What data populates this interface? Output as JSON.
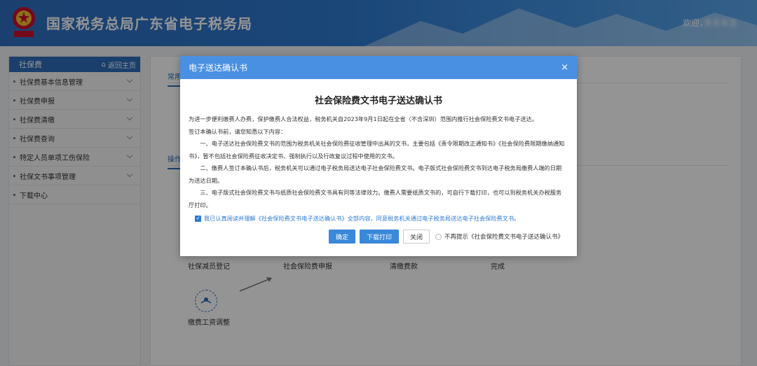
{
  "header": {
    "title": "国家税务总局广东省电子税务局",
    "welcome": "欢迎，",
    "username": "黄某某某"
  },
  "sidebar": {
    "title": "社保费",
    "home_link": "返回主页",
    "items": [
      {
        "label": "社保费基本信息管理"
      },
      {
        "label": "社保费申报"
      },
      {
        "label": "社保费清缴"
      },
      {
        "label": "社保费查询"
      },
      {
        "label": "特定人员单项工伤保险"
      },
      {
        "label": "社保文书事项管理"
      },
      {
        "label": "下载中心"
      }
    ]
  },
  "main": {
    "tab_common": "常用",
    "tab_operation": "操作",
    "steps": [
      {
        "label": "社保减员登记"
      },
      {
        "label": "社会保险费申报"
      },
      {
        "label": "清缴费款"
      },
      {
        "label": "完成"
      }
    ],
    "flow_label": "缴费工资调整"
  },
  "modal": {
    "header": "电子送达确认书",
    "close": "×",
    "title": "社会保险费文书电子送达确认书",
    "para1": "为进一步便利缴费人办费，保护缴费人合法权益，税务机关自2023年9月1日起在全省（不含深圳）范围内推行社会保险费文书电子送达。",
    "para2": "签订本确认书前，请您知悉以下内容：",
    "para3": "一、电子送达社会保险费文书的范围为税务机关社会保险费征收管理中出具的文书，主要包括《责令限期改正通知书》《社会保险费限期缴纳通知书》，暂不包括社会保险费征收决定书、强制执行以及行政复议过程中使用的文书。",
    "para4": "二、缴费人签订本确认书后，税务机关可以通过电子税务局送达电子社会保险费文书。电子版式社会保险费文书到达电子税务局缴费人端的日期为送达日期。",
    "para5": "三、电子版式社会保险费文书与纸质社会保险费文书具有同等法律效力。缴费人需要纸质文书的，可自行下载打印，也可以到税务机关办税服务厅打印。",
    "agree_text": "我已认真阅读并理解《社会保险费文书电子送达确认书》全部内容，同意税务机关通过电子税务局送达电子社会保险费文书。",
    "btn_confirm": "确定",
    "btn_download": "下载打印",
    "btn_close": "关闭",
    "no_remind": "不再提示《社会保险费文书电子送达确认书》"
  },
  "colors": {
    "header_blue": "#2f6fc0",
    "modal_header": "#4a90e2",
    "button_blue": "#3a88da",
    "link_blue": "#2e7ad0"
  }
}
